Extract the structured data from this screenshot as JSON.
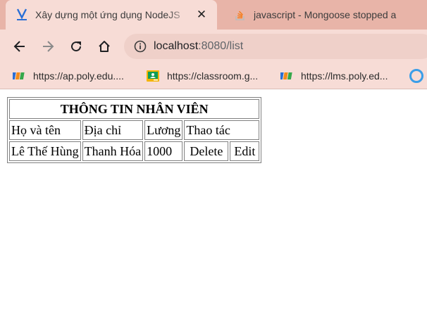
{
  "tabs": [
    {
      "title": "Xây dựng một ứng dụng NodeJS",
      "close": "✕",
      "icon": "v-logo-icon"
    },
    {
      "title": "javascript - Mongoose stopped a",
      "close": "✕",
      "icon": "stackoverflow-icon"
    }
  ],
  "omnibox": {
    "host": "localhost",
    "path": ":8080/list"
  },
  "bookmarks": [
    {
      "label": "https://ap.poly.edu....",
      "icon": "fpt-logo-icon"
    },
    {
      "label": "https://classroom.g...",
      "icon": "classroom-icon"
    },
    {
      "label": "https://lms.poly.ed...",
      "icon": "fpt-logo-icon"
    }
  ],
  "table": {
    "title": "THÔNG TIN NHÂN VIÊN",
    "headers": [
      "Họ và tên",
      "Địa chỉ",
      "Lương",
      "Thao tác"
    ],
    "rows": [
      {
        "name": "Lê Thế Hùng",
        "address": "Thanh Hóa",
        "salary": "1000",
        "delete": "Delete",
        "edit": "Edit"
      }
    ]
  },
  "colors": {
    "tabstrip": "#e8b4a8",
    "toolbar": "#f7dcd6",
    "omnibox": "#efd0c9"
  }
}
